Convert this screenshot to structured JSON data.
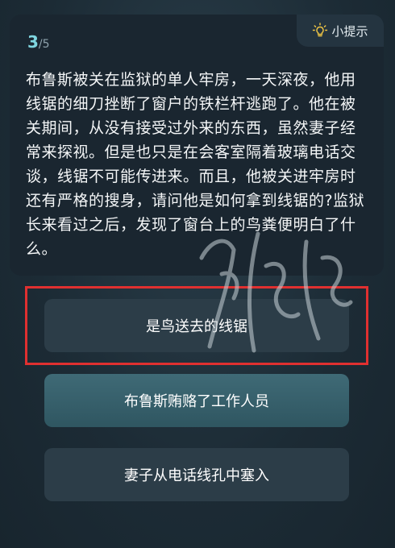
{
  "progress": {
    "current": "3",
    "total": "/5"
  },
  "hint": {
    "label": "小提示",
    "icon": "lightbulb-icon"
  },
  "question": {
    "text": "布鲁斯被关在监狱的单人牢房，一天深夜，他用线锯的细刀挫断了窗户的铁栏杆逃跑了。他在被关期间，从没有接受过外来的东西，虽然妻子经常来探视。但是也只是在会客室隔着玻璃电话交谈，线锯不可能传进来。而且，他被关进牢房时还有严格的搜身，请问他是如何拿到线锯的?监狱长来看过之后，发现了窗台上的鸟粪便明白了什么。"
  },
  "answers": [
    {
      "label": "是鸟送去的线锯"
    },
    {
      "label": "布鲁斯贿赂了工作人员"
    },
    {
      "label": "妻子从电话线孔中塞入"
    }
  ],
  "colors": {
    "accent": "#7fd6e0",
    "highlight": "#e03030",
    "selected_answer": "#3f6a76"
  }
}
